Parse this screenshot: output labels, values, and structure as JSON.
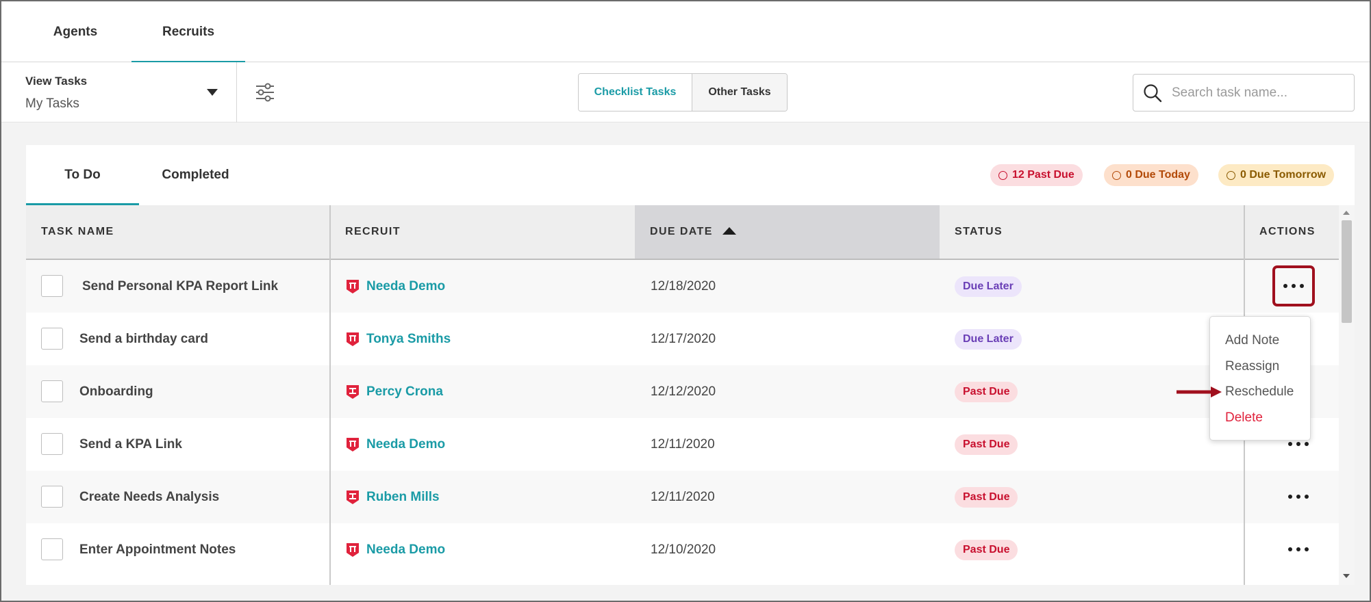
{
  "top_tabs": [
    {
      "label": "Agents"
    },
    {
      "label": "Recruits",
      "active": true
    }
  ],
  "toolbar": {
    "view_tasks_label": "View Tasks",
    "view_tasks_value": "My Tasks",
    "segments": [
      "Checklist Tasks",
      "Other Tasks"
    ],
    "search_placeholder": "Search task name..."
  },
  "sub_tabs": [
    {
      "label": "To Do",
      "active": true
    },
    {
      "label": "Completed"
    }
  ],
  "badges": {
    "past_due": "12 Past Due",
    "due_today": "0 Due Today",
    "due_tomorrow": "0 Due Tomorrow"
  },
  "table": {
    "columns": [
      "TASK NAME",
      "RECRUIT",
      "DUE DATE",
      "STATUS",
      "ACTIONS"
    ],
    "sorted_column": "DUE DATE",
    "rows": [
      {
        "task": "Send Personal KPA Report Link",
        "recruit": "Needa Demo",
        "due": "12/18/2020",
        "status": "Due Later"
      },
      {
        "task": "Send a birthday card",
        "recruit": "Tonya Smiths",
        "due": "12/17/2020",
        "status": "Due Later"
      },
      {
        "task": "Onboarding",
        "recruit": "Percy Crona",
        "due": "12/12/2020",
        "status": "Past Due"
      },
      {
        "task": "Send a KPA Link",
        "recruit": "Needa Demo",
        "due": "12/11/2020",
        "status": "Past Due"
      },
      {
        "task": "Create Needs Analysis",
        "recruit": "Ruben Mills",
        "due": "12/11/2020",
        "status": "Past Due"
      },
      {
        "task": "Enter Appointment Notes",
        "recruit": "Needa Demo",
        "due": "12/10/2020",
        "status": "Past Due"
      }
    ]
  },
  "actions_menu": {
    "items": [
      "Add Note",
      "Reassign",
      "Reschedule",
      "Delete"
    ]
  },
  "colors": {
    "accent": "#1a9ba6",
    "past_due": "#c8102e",
    "due_later": "#6a3fb6",
    "highlight": "#a0101e",
    "recruit_icon": "#e0223c"
  }
}
